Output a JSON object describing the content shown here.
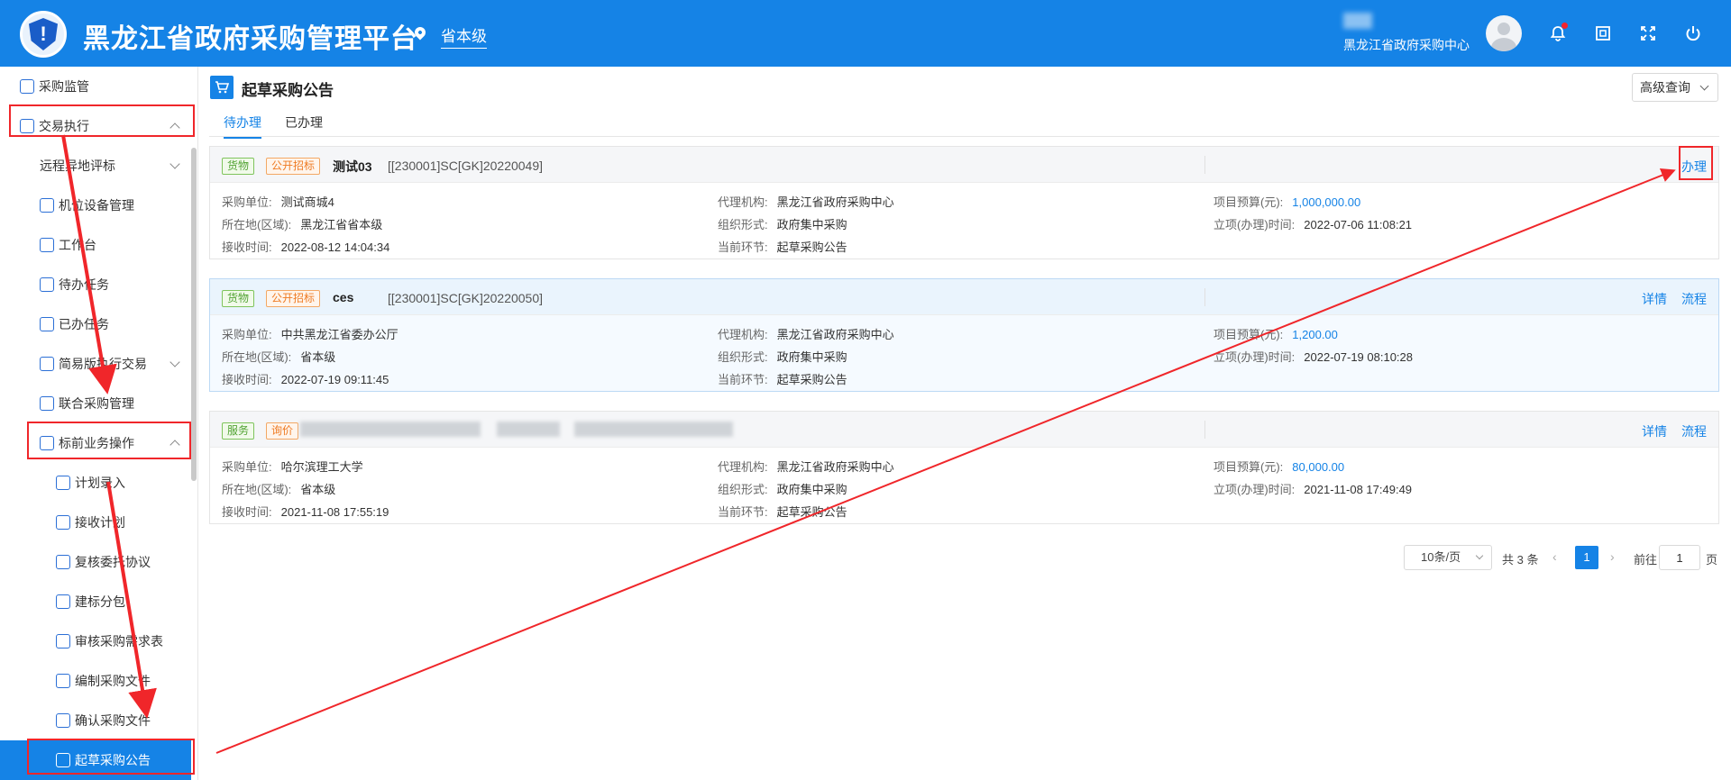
{
  "header": {
    "app_title": "黑龙江省政府采购管理平台",
    "region": "省本级",
    "user_org": "黑龙江省政府采购中心",
    "colors": {
      "primary": "#1583e6",
      "accent_red": "#f0262a"
    },
    "icons": [
      "map-pin-icon",
      "bell-icon",
      "window-icon",
      "expand-icon",
      "power-icon"
    ]
  },
  "sidebar": {
    "items": [
      {
        "label": "采购监管",
        "icon": "shield-icon"
      },
      {
        "label": "交易执行",
        "icon": "clipboard-icon"
      },
      {
        "label": "远程异地评标"
      },
      {
        "label": "机位设备管理",
        "icon": "device-icon"
      },
      {
        "label": "工作台",
        "icon": "desk-icon"
      },
      {
        "label": "待办任务",
        "icon": "task-icon"
      },
      {
        "label": "已办任务",
        "icon": "done-task-icon"
      },
      {
        "label": "简易版执行交易",
        "icon": "exchange-icon"
      },
      {
        "label": "联合采购管理",
        "icon": "joint-icon"
      },
      {
        "label": "标前业务操作",
        "icon": "cart-icon"
      },
      {
        "label": "计划录入",
        "icon": "plan-icon"
      },
      {
        "label": "接收计划",
        "icon": "receive-icon"
      },
      {
        "label": "复核委托协议",
        "icon": "agreement-icon"
      },
      {
        "label": "建标分包",
        "icon": "package-icon"
      },
      {
        "label": "审核采购需求表",
        "icon": "audit-icon"
      },
      {
        "label": "编制采购文件",
        "icon": "file-icon"
      },
      {
        "label": "确认采购文件",
        "icon": "confirm-file-icon"
      },
      {
        "label": "起草采购公告",
        "icon": "cart-icon"
      }
    ]
  },
  "main": {
    "page_title": "起草采购公告",
    "advanced_query": "高级查询",
    "tabs": [
      {
        "label": "待办理"
      },
      {
        "label": "已办理"
      }
    ],
    "labels": {
      "purchaser": "采购单位:",
      "agency": "代理机构:",
      "budget": "项目预算(元):",
      "location": "所在地(区域):",
      "org_form": "组织形式:",
      "setup_time": "立项(办理)时间:",
      "receive_time": "接收时间:",
      "current_step": "当前环节:"
    },
    "cards": [
      {
        "tags": [
          "货物",
          "公开招标"
        ],
        "name": "测试03",
        "code": "[[230001]SC[GK]20220049]",
        "actions": [
          "办理"
        ],
        "purchaser": "测试商城4",
        "agency": "黑龙江省政府采购中心",
        "budget": "1,000,000.00",
        "location": "黑龙江省省本级",
        "org_form": "政府集中采购",
        "setup_time": "2022-07-06 11:08:21",
        "receive_time": "2022-08-12 14:04:34",
        "current_step": "起草采购公告"
      },
      {
        "tags": [
          "货物",
          "公开招标"
        ],
        "name": "ces",
        "code": "[[230001]SC[GK]20220050]",
        "actions": [
          "详情",
          "流程"
        ],
        "purchaser": "中共黑龙江省委办公厅",
        "agency": "黑龙江省政府采购中心",
        "budget": "1,200.00",
        "location": "省本级",
        "org_form": "政府集中采购",
        "setup_time": "2022-07-19 08:10:28",
        "receive_time": "2022-07-19 09:11:45",
        "current_step": "起草采购公告"
      },
      {
        "tags": [
          "服务",
          "询价"
        ],
        "name": "",
        "code": "",
        "actions": [
          "详情",
          "流程"
        ],
        "purchaser": "哈尔滨理工大学",
        "agency": "黑龙江省政府采购中心",
        "budget": "80,000.00",
        "location": "省本级",
        "org_form": "政府集中采购",
        "setup_time": "2021-11-08 17:49:49",
        "receive_time": "2021-11-08 17:55:19",
        "current_step": "起草采购公告"
      }
    ]
  },
  "pagination": {
    "page_size": "10条/页",
    "total": "共 3 条",
    "current_page": "1",
    "goto_label": "前往",
    "goto_value": "1",
    "unit": "页"
  }
}
